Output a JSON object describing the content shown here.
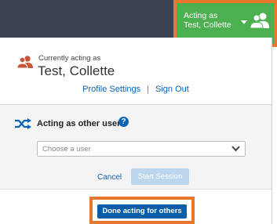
{
  "header": {
    "acting_line1": "Acting as",
    "acting_line2": "Test, Collette",
    "users_icon": "users-icon",
    "caret_icon": "caret-down-icon"
  },
  "current": {
    "label": "Currently acting as",
    "name": "Test, Collette",
    "icon": "users-icon"
  },
  "links": {
    "profile_settings": "Profile Settings",
    "separator": "|",
    "sign_out": "Sign Out"
  },
  "acting_other": {
    "title": "Acting as other user",
    "help_glyph": "?",
    "select_placeholder": "Choose a user",
    "cancel_label": "Cancel",
    "start_label": "Start Session",
    "shuffle_icon": "shuffle-icon",
    "chevron_icon": "chevron-down-icon"
  },
  "done_label": "Done acting for others",
  "colors": {
    "topbar": "#3d4450",
    "badge_green": "#4caf50",
    "highlight_orange": "#e8772e",
    "link_blue": "#0b63b6",
    "primary_button": "#0a5ea8",
    "disabled_button": "#bcd6ee",
    "user_icon_red": "#c8563a"
  }
}
